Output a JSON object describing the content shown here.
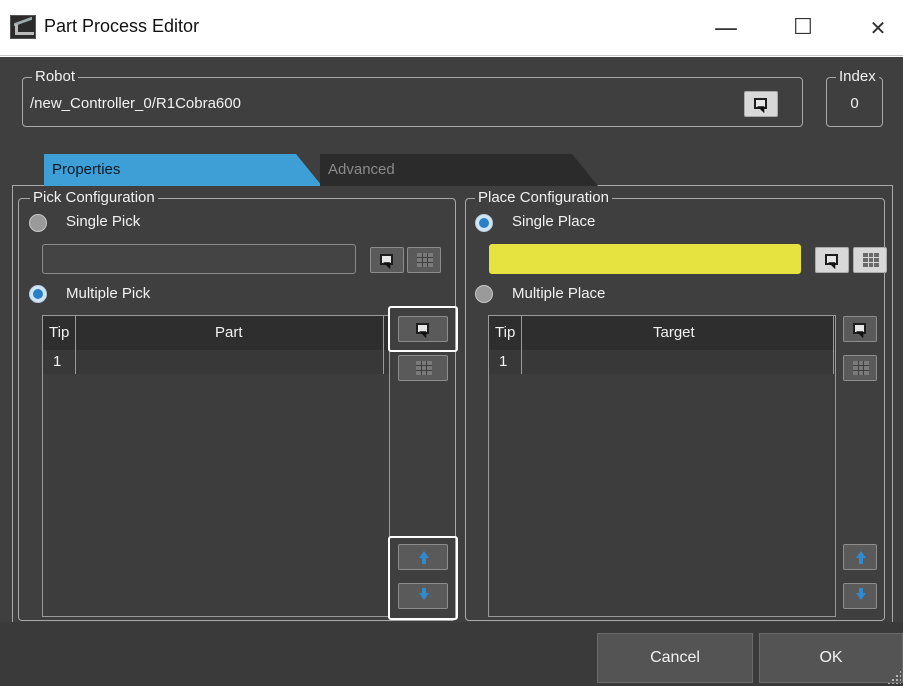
{
  "window": {
    "title": "Part Process Editor",
    "minimize": "—",
    "maximize": "☐",
    "close": "✕"
  },
  "robot": {
    "label": "Robot",
    "path": "/new_Controller_0/R1Cobra600",
    "select_icon": "select-cursor-icon"
  },
  "index": {
    "label": "Index",
    "value": "0"
  },
  "tabs": [
    {
      "label": "Properties",
      "active": true
    },
    {
      "label": "Advanced",
      "active": false
    }
  ],
  "pick": {
    "group_label": "Pick Configuration",
    "single_label": "Single Pick",
    "single_checked": false,
    "single_value": "",
    "multiple_label": "Multiple Pick",
    "multiple_checked": true,
    "table": {
      "columns": [
        "Tip",
        "Part"
      ],
      "rows": [
        {
          "tip": "1",
          "part": ""
        }
      ]
    }
  },
  "place": {
    "group_label": "Place Configuration",
    "single_label": "Single Place",
    "single_checked": true,
    "single_value": "",
    "single_field_color": "#e6e23f",
    "multiple_label": "Multiple Place",
    "multiple_checked": false,
    "table": {
      "columns": [
        "Tip",
        "Target"
      ],
      "rows": [
        {
          "tip": "1",
          "target": ""
        }
      ]
    }
  },
  "buttons": {
    "cancel": "Cancel",
    "ok": "OK"
  },
  "colors": {
    "accent": "#3e9fd6",
    "background": "#3f3f3f",
    "highlight_field": "#e6e23f"
  }
}
